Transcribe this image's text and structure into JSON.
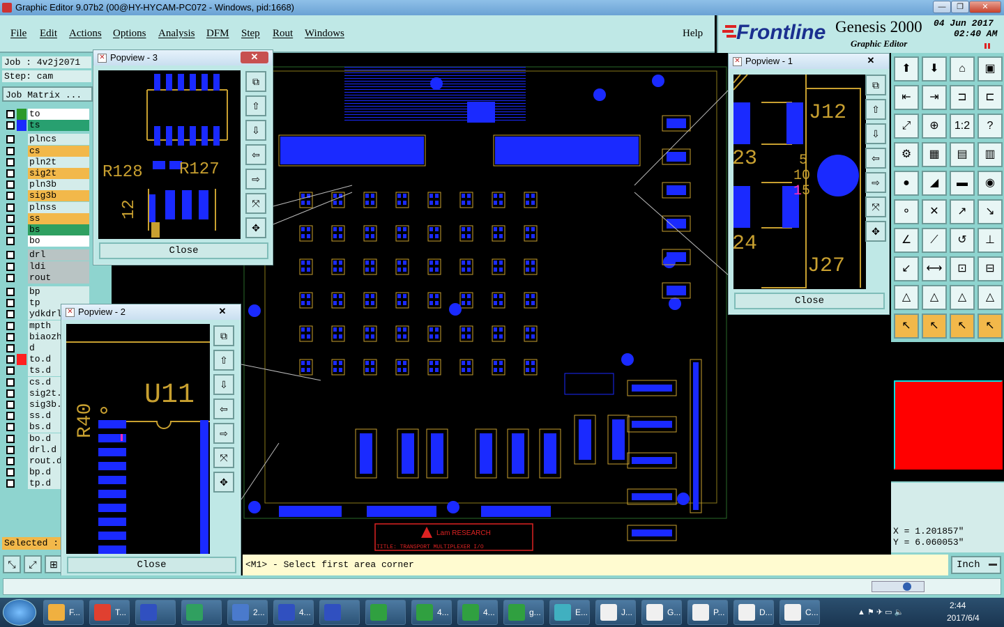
{
  "window": {
    "title": "Graphic Editor 9.07b2 (00@HY-HYCAM-PC072 - Windows, pid:1668)"
  },
  "menu": {
    "items": [
      "File",
      "Edit",
      "Actions",
      "Options",
      "Analysis",
      "DFM",
      "Step",
      "Rout",
      "Windows"
    ],
    "help": "Help"
  },
  "brand": {
    "logo": "Frontline",
    "product": "Genesis 2000",
    "subtitle": "Graphic Editor",
    "date": "04 Jun 2017",
    "time": "02:40 AM"
  },
  "left": {
    "job": "Job : 4v2j2071",
    "step": "Step: cam",
    "job_matrix": "Job Matrix ...",
    "selected_label": "Selected :",
    "layers": [
      {
        "name": "to",
        "color": "#2a9a2a",
        "bg": "#ffffff"
      },
      {
        "name": "ts",
        "color": "#1a2aff",
        "bg": "#28a070"
      },
      {
        "name": "plncs",
        "color": "",
        "bg": "#d4ecea"
      },
      {
        "name": "cs",
        "color": "",
        "bg": "#f2b84a"
      },
      {
        "name": "pln2t",
        "color": "",
        "bg": "#d4ecea"
      },
      {
        "name": "sig2t",
        "color": "",
        "bg": "#f2b84a"
      },
      {
        "name": "pln3b",
        "color": "",
        "bg": "#d4ecea"
      },
      {
        "name": "sig3b",
        "color": "",
        "bg": "#f2b84a"
      },
      {
        "name": "plnss",
        "color": "",
        "bg": "#d4ecea"
      },
      {
        "name": "ss",
        "color": "",
        "bg": "#f2b84a"
      },
      {
        "name": "bs",
        "color": "",
        "bg": "#2fa060"
      },
      {
        "name": "bo",
        "color": "",
        "bg": "#ffffff"
      },
      {
        "name": "drl",
        "color": "",
        "bg": "#b9c4c4"
      },
      {
        "name": "ldi",
        "color": "",
        "bg": "#b9c4c4"
      },
      {
        "name": "rout",
        "color": "",
        "bg": "#b9c4c4"
      },
      {
        "name": "bp",
        "color": "",
        "bg": "#d4ecea"
      },
      {
        "name": "tp",
        "color": "",
        "bg": "#d4ecea"
      },
      {
        "name": "ydkdrl",
        "color": "",
        "bg": "#d4ecea"
      },
      {
        "name": "mpth",
        "color": "",
        "bg": "#d4ecea"
      },
      {
        "name": "biaozh",
        "color": "",
        "bg": "#d4ecea"
      },
      {
        "name": "d",
        "color": "",
        "bg": "#d4ecea"
      },
      {
        "name": "to.d",
        "color": "#ff2020",
        "bg": "#d4ecea"
      },
      {
        "name": "ts.d",
        "color": "",
        "bg": "#d4ecea"
      },
      {
        "name": "cs.d",
        "color": "",
        "bg": "#d4ecea"
      },
      {
        "name": "sig2t.",
        "color": "",
        "bg": "#d4ecea"
      },
      {
        "name": "sig3b.",
        "color": "",
        "bg": "#d4ecea"
      },
      {
        "name": "ss.d",
        "color": "",
        "bg": "#d4ecea"
      },
      {
        "name": "bs.d",
        "color": "",
        "bg": "#d4ecea"
      },
      {
        "name": "bo.d",
        "color": "",
        "bg": "#d4ecea"
      },
      {
        "name": "drl.d",
        "color": "",
        "bg": "#d4ecea"
      },
      {
        "name": "rout.d",
        "color": "",
        "bg": "#d4ecea"
      },
      {
        "name": "bp.d",
        "color": "",
        "bg": "#d4ecea"
      },
      {
        "name": "tp.d",
        "color": "",
        "bg": "#d4ecea"
      }
    ]
  },
  "popups": {
    "p3": {
      "title": "Popview - 3",
      "close": "Close",
      "labels": [
        "R128",
        "R127",
        "12"
      ]
    },
    "p2": {
      "title": "Popview - 2",
      "close": "Close",
      "labels": [
        "U11",
        "R40"
      ]
    },
    "p1": {
      "title": "Popview - 1",
      "close": "Close",
      "labels": [
        "J12",
        "23",
        "24",
        "J27",
        "5",
        "10",
        "15",
        "1"
      ]
    }
  },
  "board": {
    "title_block": "TITLE: TRANSPORT MULTIPLEXER I/O",
    "logo_text": "Lam RESEARCH"
  },
  "coords": {
    "x": "X = 1.201857\"",
    "y": "Y = 6.060053\""
  },
  "units": "Inch",
  "command": "<M1> - Select first area corner",
  "taskbar": {
    "items": [
      "F...",
      "T...",
      "",
      "",
      "2...",
      "4...",
      "",
      "",
      "4...",
      "4...",
      "g...",
      "E...",
      "J...",
      "G...",
      "P...",
      "D...",
      "C..."
    ],
    "clock_time": "2:44",
    "clock_date": "2017/6/4"
  }
}
